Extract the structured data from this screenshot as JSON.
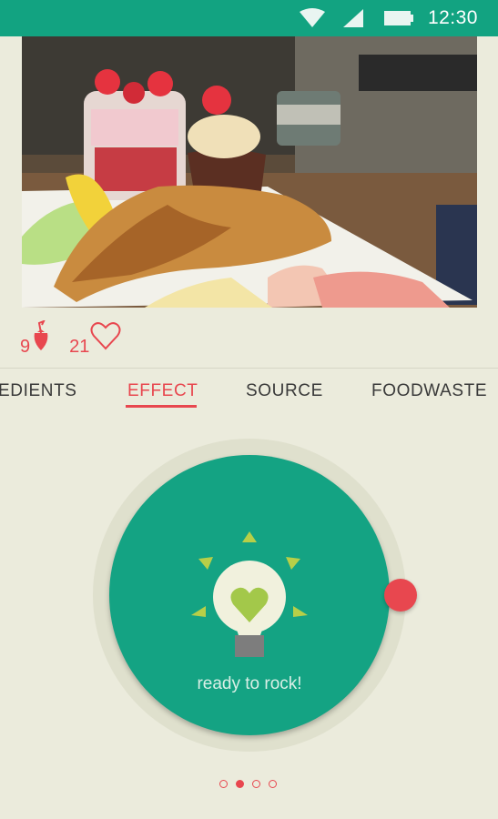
{
  "status_bar": {
    "time": "12:30",
    "icons": [
      "wifi-icon",
      "signal-icon",
      "battery-icon"
    ]
  },
  "post": {
    "photo_subject": "breakfast plate with croissant, strawberry parfait and cupcake",
    "stats": {
      "strawberries": "9",
      "likes": "21"
    }
  },
  "tabs": {
    "items": [
      {
        "label": "EDIENTS"
      },
      {
        "label": "EFFECT"
      },
      {
        "label": "SOURCE"
      },
      {
        "label": "FOODWASTE"
      }
    ],
    "active": "EFFECT"
  },
  "effect": {
    "icon": "lightbulb-heart-icon",
    "message": "ready to rock!"
  },
  "pager": {
    "count": 4,
    "active_index": 1
  },
  "colors": {
    "primary": "#12a381",
    "accent": "#e8474f",
    "background": "#ebebdc"
  }
}
